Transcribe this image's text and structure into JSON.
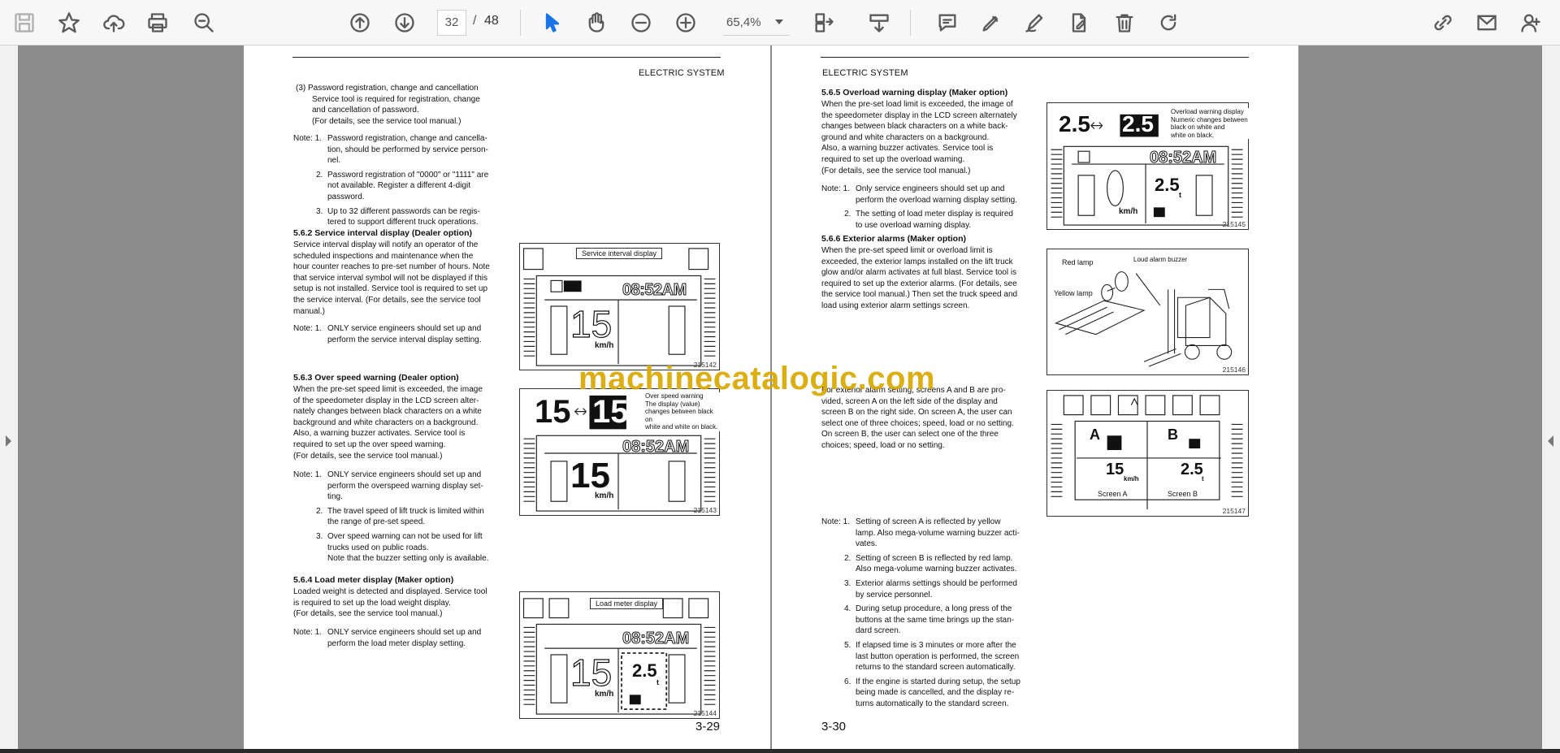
{
  "toolbar": {
    "page_current": "32",
    "page_sep": "/",
    "page_total": "48",
    "zoom": "65,4%"
  },
  "watermark": "machinecatalogic.com",
  "left_page": {
    "header": "ELECTRIC SYSTEM",
    "page_number": "3-29",
    "sec3": {
      "lines": [
        "(3)  Password registration, change and cancellation",
        "Service tool is required for registration, change",
        "and cancellation of password.",
        "(For details, see the service tool manual.)"
      ],
      "note_label": "Note: 1.",
      "notes": [
        {
          "n": "1.",
          "lines": [
            "Password registration, change and cancella-",
            "tion, should be performed by service person-",
            "nel."
          ]
        },
        {
          "n": "2.",
          "lines": [
            "Password registration of \"0000\" or \"1111\" are",
            "not available. Register a different 4-digit",
            "password."
          ]
        },
        {
          "n": "3.",
          "lines": [
            "Up to 32 different passwords can be regis-",
            "tered to support different truck operations."
          ]
        }
      ]
    },
    "s562": {
      "title": "5.6.2   Service interval display (Dealer option)",
      "lines": [
        "Service interval display will notify an operator of the",
        "scheduled inspections and maintenance when the",
        "hour counter reaches to pre-set number of hours. Note",
        "that service interval symbol will not be displayed if this",
        "setup is not installed. Service tool is required to set up",
        "the service interval. (For details, see the service tool",
        "manual.)"
      ],
      "note_label": "Note: 1.",
      "note": [
        "ONLY service engineers should set up and",
        "perform the service interval display setting."
      ],
      "fig_label": "Service interval display",
      "fig_code": "215142"
    },
    "s563": {
      "title": "5.6.3   Over speed warning (Dealer option)",
      "lines": [
        "When the pre-set speed limit is exceeded, the image",
        "of the speedometer display in the LCD screen alter-",
        "nately changes between black characters on a white",
        "background and white characters on a background.",
        "Also, a warning buzzer activates. Service tool is",
        "required to set up the over speed warning.",
        "(For details, see the service tool manual.)"
      ],
      "note_label": "Note: 1.",
      "notes": [
        {
          "n": "1.",
          "lines": [
            "ONLY service engineers should set up and",
            "perform the overspeed warning display set-",
            "ting."
          ]
        },
        {
          "n": "2.",
          "lines": [
            "The travel speed of lift truck is limited within",
            "the range of pre-set speed."
          ]
        },
        {
          "n": "3.",
          "lines": [
            "Over speed warning can not be used for lift",
            "trucks used on public roads.",
            "Note that the buzzer setting only is available."
          ]
        }
      ],
      "fig_label": [
        "Over speed warning",
        "The display (value)",
        "changes between black on",
        "white and white on black."
      ],
      "fig_code": "215143"
    },
    "s564": {
      "title": "5.6.4   Load meter display (Maker option)",
      "lines": [
        "Loaded weight is detected and displayed. Service tool",
        "is required to set up the load weight display.",
        "(For details, see the service tool manual.)"
      ],
      "note_label": "Note: 1.",
      "note": [
        "ONLY service engineers should set up and",
        "perform the load meter display setting."
      ],
      "fig_label": "Load meter display",
      "fig_code": "215144"
    },
    "lcd": {
      "time": "08:52AM",
      "speed": "15",
      "unit": "km/h",
      "load": "2.5",
      "load_unit": "t"
    }
  },
  "right_page": {
    "header": "ELECTRIC SYSTEM",
    "page_number": "3-30",
    "s565": {
      "title": "5.6.5   Overload warning display (Maker option)",
      "lines": [
        "When the pre-set load limit is exceeded, the image of",
        "the speedometer display in the LCD screen alternately",
        "changes between black characters on a white back-",
        "ground and white characters on a background.",
        "Also, a warning buzzer activates. Service tool is",
        "required to set up the overload warning.",
        "(For details, see the service tool manual.)"
      ],
      "note_label": "Note: 1.",
      "notes": [
        {
          "n": "1.",
          "lines": [
            "Only service engineers should set up and",
            "perform the overload warning display setting."
          ]
        },
        {
          "n": "2.",
          "lines": [
            "The setting of load meter display is required",
            "to use overload warning display."
          ]
        }
      ],
      "fig_label": [
        "Overload warning display",
        "Numeric changes between",
        "black on white and",
        "white on black."
      ],
      "fig_code": "215145"
    },
    "s566": {
      "title": "5.6.6   Exterior alarms (Maker option)",
      "lines": [
        "When the pre-set speed limit or overload limit is",
        "exceeded, the exterior lamps installed on the lift truck",
        "glow and/or alarm activates at full blast. Service tool is",
        "required to set up the exterior alarms. (For details, see",
        "the service tool manual.) Then set the truck speed and",
        "load using exterior alarm settings screen."
      ],
      "lines2": [
        "For exterior alarm setting, screens A and B are pro-",
        "vided, screen A on the left side of the display and",
        "screen B on the right side. On screen A, the user can",
        "select one of three choices; speed, load or no setting.",
        "On screen B, the user can select one of the three",
        "choices; speed, load or no setting."
      ],
      "fig_red": "Red lamp",
      "fig_yellow": "Yellow lamp",
      "fig_buzzer": "Loud alarm buzzer",
      "fig_code": "215146",
      "screen_a": "Screen A",
      "screen_b": "Screen B",
      "fig2_code": "215147",
      "note_label": "Note: 1.",
      "notes": [
        {
          "n": "1.",
          "lines": [
            "Setting of screen A is reflected by yellow",
            "lamp. Also mega-volume warning buzzer acti-",
            "vates."
          ]
        },
        {
          "n": "2.",
          "lines": [
            "Setting of screen B is reflected by red lamp.",
            "Also mega-volume warning buzzer activates."
          ]
        },
        {
          "n": "3.",
          "lines": [
            "Exterior alarms settings should be performed",
            "by service personnel."
          ]
        },
        {
          "n": "4.",
          "lines": [
            "During setup procedure, a long press of the",
            "buttons at the same time brings up the stan-",
            "dard screen."
          ]
        },
        {
          "n": "5.",
          "lines": [
            "If elapsed time is 3 minutes or more after the",
            "last button operation is performed, the screen",
            "returns to the standard screen automatically."
          ]
        },
        {
          "n": "6.",
          "lines": [
            "If the engine is started during setup, the setup",
            "being made is cancelled, and the display re-",
            "turns automatically to the standard screen."
          ]
        }
      ]
    },
    "scr_a_letter": "A",
    "scr_b_letter": "B"
  }
}
